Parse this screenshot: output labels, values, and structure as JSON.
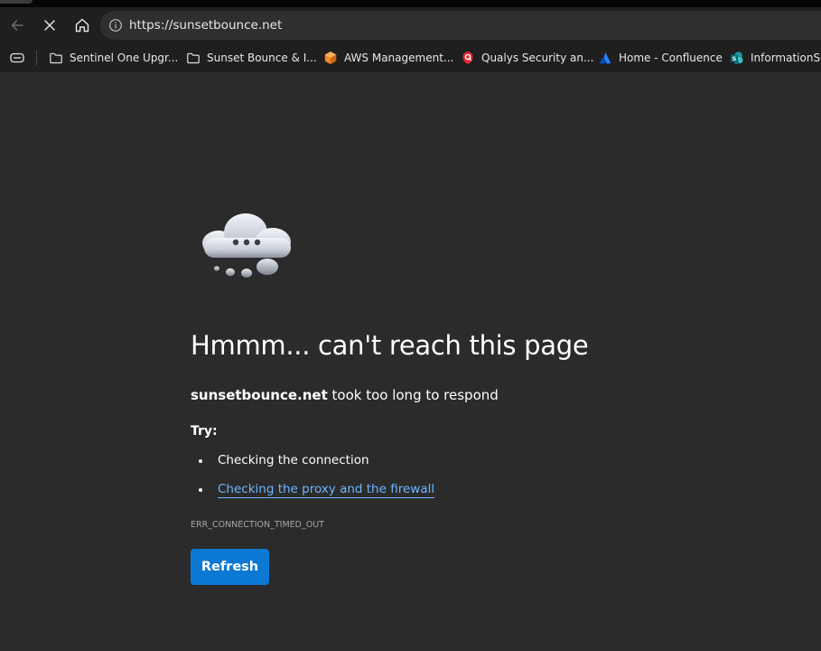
{
  "address_bar": {
    "url": "https://sunsetbounce.net"
  },
  "toolbar": {
    "back_icon": "arrow-left-icon",
    "stop_icon": "close-icon",
    "home_icon": "home-icon",
    "site_info_icon": "info-icon"
  },
  "bookmarks": [
    {
      "label": "Sentinel One Upgr...",
      "icon": "folder-icon"
    },
    {
      "label": "Sunset Bounce & I...",
      "icon": "folder-icon"
    },
    {
      "label": "AWS Management...",
      "icon": "aws-cube-icon",
      "color": "#f08a24"
    },
    {
      "label": "Qualys Security an...",
      "icon": "qualys-icon",
      "color": "#e8262f"
    },
    {
      "label": "Home - Confluence",
      "icon": "confluence-icon",
      "color": "#2684ff"
    },
    {
      "label": "InformationSec",
      "icon": "sharepoint-icon",
      "color": "#1a9ba1"
    }
  ],
  "error_page": {
    "headline": "Hmmm... can't reach this page",
    "host": "sunsetbounce.net",
    "message": " took too long to respond",
    "try_label": "Try:",
    "suggestions": [
      {
        "text": "Checking the connection",
        "is_link": false
      },
      {
        "text": "Checking the proxy and the firewall",
        "is_link": true
      }
    ],
    "error_code": "ERR_CONNECTION_TIMED_OUT",
    "refresh_label": "Refresh",
    "illustration": "thinking-cloud-icon"
  },
  "colors": {
    "page_background": "#2b2b2b",
    "toolbar_background": "#1f1f1f",
    "link": "#6cb6ff",
    "accent_button": "#0b78d4"
  }
}
